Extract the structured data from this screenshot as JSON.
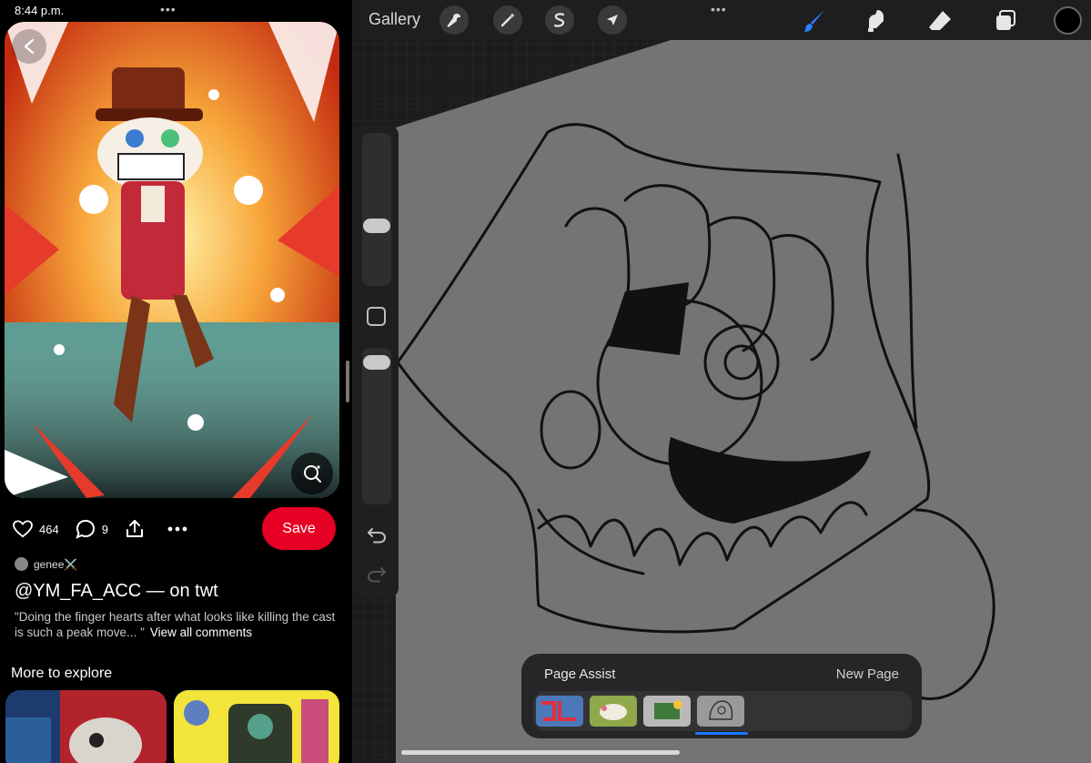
{
  "status_bar": {
    "time": "8:44 p.m.",
    "dots": "•••"
  },
  "pinterest": {
    "back_icon": "chevron-left-icon",
    "lens_icon": "visual-search-icon",
    "actions": {
      "likes": "464",
      "comments": "9"
    },
    "save_label": "Save",
    "author": "genee⚔️",
    "title": "@YM_FA_ACC — on twt",
    "description": "\"Doing the finger hearts after what looks like killing the cast is such a peak move... \"",
    "view_all": "View all comments",
    "more_to_explore": "More to explore",
    "accent": "#e60023"
  },
  "procreate": {
    "gallery_label": "Gallery",
    "tools_left": [
      "wrench-icon",
      "magic-wand-icon",
      "selection-icon",
      "arrow-icon"
    ],
    "tools_right": [
      "brush-icon",
      "smudge-icon",
      "eraser-icon",
      "layers-icon"
    ],
    "dots": "•••",
    "active_tool_color": "#2f80ff",
    "color_well": "#000000",
    "page_assist": {
      "title": "Page Assist",
      "new_page": "New Page",
      "selected_index": 3,
      "highlight": "#1a78ff"
    }
  }
}
